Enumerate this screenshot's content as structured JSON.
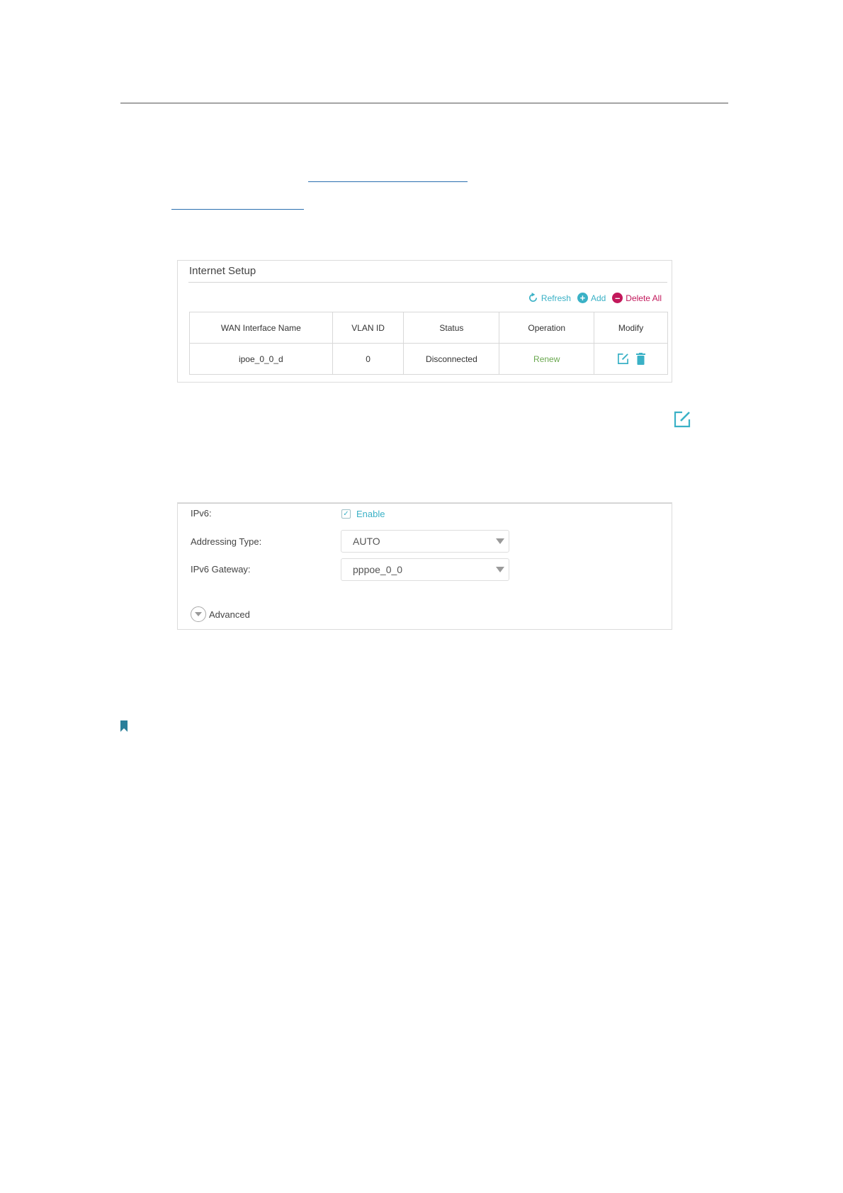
{
  "internet_setup": {
    "title": "Internet Setup",
    "toolbar": {
      "refresh_label": "Refresh",
      "add_label": "Add",
      "delete_all_label": "Delete All"
    },
    "table": {
      "headers": [
        "WAN Interface Name",
        "VLAN ID",
        "Status",
        "Operation",
        "Modify"
      ],
      "rows": [
        {
          "wan_interface_name": "ipoe_0_0_d",
          "vlan_id": "0",
          "status": "Disconnected",
          "operation": "Renew"
        }
      ]
    }
  },
  "ipv6_settings": {
    "ipv6_label": "IPv6:",
    "enable_label": "Enable",
    "enable_checked": true,
    "addressing_type_label": "Addressing Type:",
    "addressing_type_value": "AUTO",
    "ipv6_gateway_label": "IPv6 Gateway:",
    "ipv6_gateway_value": "pppoe_0_0",
    "advanced_label": "Advanced"
  },
  "colors": {
    "accent": "#3ab1c6",
    "danger": "#c2185b",
    "success": "#6aa84f"
  },
  "icons": [
    "refresh-icon",
    "add-icon",
    "delete-icon",
    "edit-icon",
    "trash-icon",
    "checkbox-icon",
    "chevron-down-icon",
    "bookmark-icon"
  ]
}
